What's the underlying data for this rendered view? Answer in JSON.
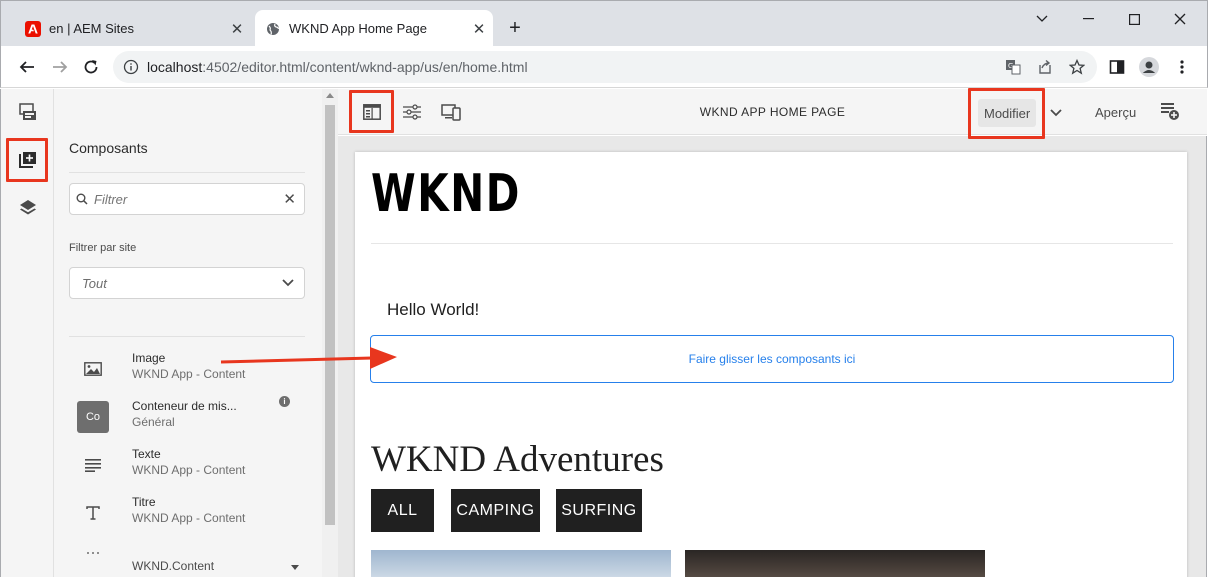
{
  "browser": {
    "tabs": [
      {
        "title": "en | AEM Sites",
        "favicon": "adobe-icon"
      },
      {
        "title": "WKND App Home Page",
        "favicon": "globe-icon",
        "active": true
      }
    ],
    "new_tab": "+",
    "address": {
      "host": "localhost",
      "path": ":4502/editor.html/content/wknd-app/us/en/home.html"
    }
  },
  "rail": {
    "items": [
      "page-properties-icon",
      "components-icon",
      "layers-icon"
    ]
  },
  "panel": {
    "title": "Composants",
    "filter_placeholder": "Filtrer",
    "site_filter_label": "Filtrer par site",
    "site_filter_value": "Tout",
    "components": [
      {
        "name": "Image",
        "group": "WKND App - Content",
        "icon": "image-icon"
      },
      {
        "name": "Conteneur de mis...",
        "group": "Général",
        "icon": "Co"
      },
      {
        "name": "Texte",
        "group": "WKND App - Content",
        "icon": "text-icon"
      },
      {
        "name": "Titre",
        "group": "WKND App - Content",
        "icon": "title-icon"
      },
      {
        "name": "WKND.Content",
        "group": "",
        "icon": "more-icon"
      }
    ]
  },
  "editor": {
    "page_title": "WKND APP HOME PAGE",
    "mode": "Modifier",
    "preview": "Aperçu"
  },
  "page": {
    "logo": "WKND",
    "hello": "Hello World!",
    "dropzone": "Faire glisser les composants ici",
    "adventures_title": "WKND Adventures",
    "filters": [
      "ALL",
      "CAMPING",
      "SURFING"
    ]
  },
  "colors": {
    "highlight": "#e8361e",
    "accent": "#2680eb",
    "button_dark": "#202020"
  }
}
